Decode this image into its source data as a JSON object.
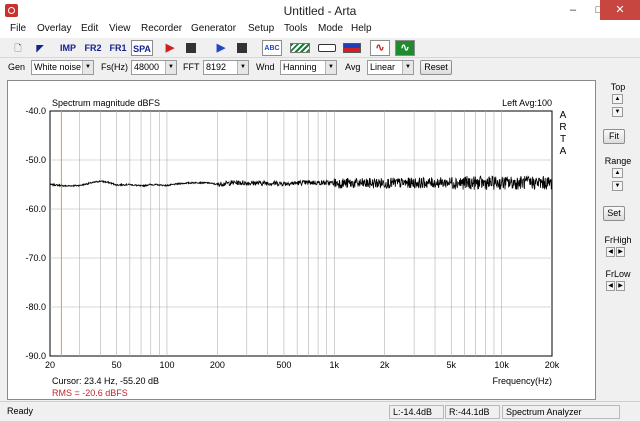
{
  "window": {
    "title": "Untitled - Arta",
    "minimize": "–",
    "maximize": "□",
    "close": "✕"
  },
  "menu": [
    "File",
    "Overlay",
    "Edit",
    "View",
    "Recorder",
    "Generator",
    "Setup",
    "Tools",
    "Mode",
    "Help"
  ],
  "toolbar": {
    "imp": "IMP",
    "fr2": "FR2",
    "fr1": "FR1",
    "spa": "SPA",
    "icons": [
      "new-file-icon",
      "open-icon",
      "imp-mode-icon",
      "fr2-mode-icon",
      "fr1-mode-icon",
      "spa-mode-icon",
      "record-icon",
      "stop-icon",
      "play-icon",
      "stop-play-icon",
      "abc-icon",
      "stripes-icon",
      "input-icon",
      "color-bar-icon",
      "red-wave-icon",
      "green-wave-icon"
    ]
  },
  "settings": {
    "gen_label": "Gen",
    "gen_value": "White noise",
    "fs_label": "Fs(Hz)",
    "fs_value": "48000",
    "fft_label": "FFT",
    "fft_value": "8192",
    "wnd_label": "Wnd",
    "wnd_value": "Hanning",
    "avg_label": "Avg",
    "avg_value": "Linear",
    "reset": "Reset"
  },
  "plot": {
    "title": "Spectrum magnitude dBFS",
    "info": "Left  Avg:100",
    "brand_letters": [
      "A",
      "R",
      "T",
      "A"
    ],
    "cursor": "Cursor:   23.4 Hz, -55.20 dB",
    "rms": "RMS =  -20.6 dBFS",
    "cursor_color": "#d8a52b",
    "rms_color": "#c0262b"
  },
  "side_panel": {
    "top": "Top",
    "fit": "Fit",
    "range": "Range",
    "set": "Set",
    "frhigh": "FrHigh",
    "frlow": "FrLow",
    "up": "▲",
    "down": "▼",
    "left": "◀",
    "right": "▶"
  },
  "status": {
    "ready": "Ready",
    "left_level": "L:-14.4dB",
    "right_level": "R:-44.1dB",
    "mode": "Spectrum Analyzer"
  },
  "chart_data": {
    "type": "line",
    "title": "Spectrum magnitude dBFS",
    "xlabel": "Frequency(Hz)",
    "ylabel": "",
    "xscale": "log",
    "xlim": [
      20,
      20000
    ],
    "ylim": [
      -90,
      -40
    ],
    "grid": true,
    "x_tick_labels": [
      {
        "f": 20,
        "label": "20"
      },
      {
        "f": 50,
        "label": "50"
      },
      {
        "f": 100,
        "label": "100"
      },
      {
        "f": 200,
        "label": "200"
      },
      {
        "f": 500,
        "label": "500"
      },
      {
        "f": 1000,
        "label": "1k"
      },
      {
        "f": 2000,
        "label": "2k"
      },
      {
        "f": 5000,
        "label": "5k"
      },
      {
        "f": 10000,
        "label": "10k"
      },
      {
        "f": 20000,
        "label": "20k"
      }
    ],
    "y_tick_labels": [
      {
        "v": -40,
        "label": "-40.0"
      },
      {
        "v": -50,
        "label": "-50.0"
      },
      {
        "v": -60,
        "label": "-60.0"
      },
      {
        "v": -70,
        "label": "-70.0"
      },
      {
        "v": -80,
        "label": "-80.0"
      },
      {
        "v": -90,
        "label": "-90.0"
      }
    ],
    "cursor_x": 23.4,
    "series": [
      {
        "x": [
          20,
          25,
          30,
          35,
          40,
          45,
          50,
          60,
          70,
          80,
          100,
          120,
          150,
          180,
          200,
          250,
          300,
          400,
          500,
          700,
          1000,
          1500,
          2000,
          3000,
          5000,
          7000,
          10000,
          15000,
          20000
        ],
        "y": [
          -55.0,
          -55.3,
          -55.2,
          -54.7,
          -54.3,
          -54.6,
          -55.1,
          -55.0,
          -55.3,
          -55.0,
          -55.2,
          -54.8,
          -54.6,
          -54.7,
          -55.0,
          -54.6,
          -54.7,
          -54.7,
          -54.8,
          -54.6,
          -54.7,
          -54.8,
          -54.7,
          -54.7,
          -54.6,
          -54.7,
          -54.7,
          -54.6,
          -54.7
        ]
      }
    ]
  }
}
